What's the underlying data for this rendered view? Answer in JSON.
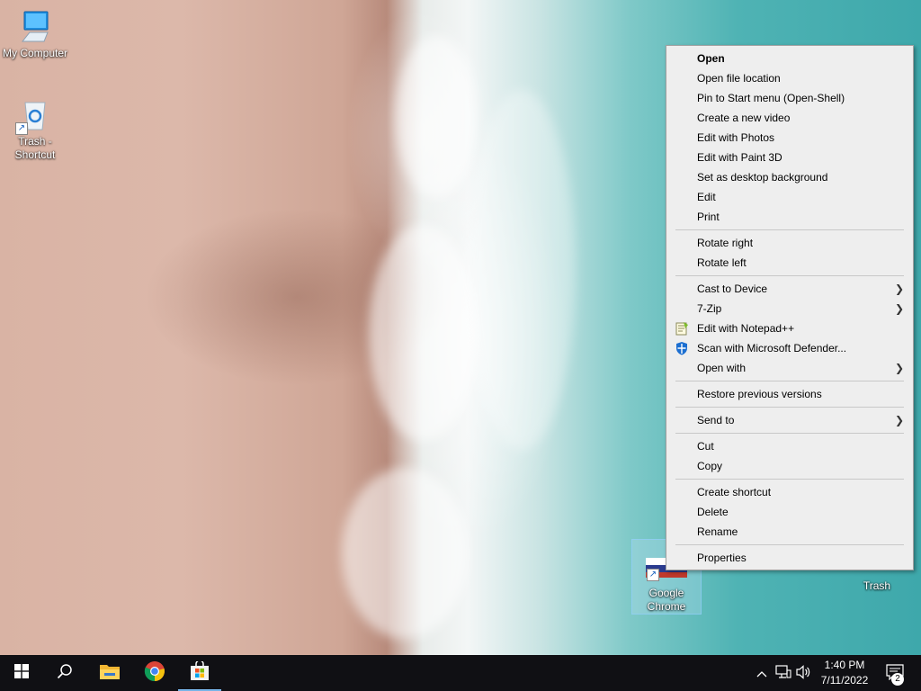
{
  "desktop": {
    "icons": [
      {
        "label": "My Computer"
      },
      {
        "label": "Trash - Shortcut"
      },
      {
        "label": "Google Chrome"
      },
      {
        "label": "Trash"
      }
    ]
  },
  "context_menu": {
    "groups": [
      [
        "Open",
        "Open file location",
        "Pin to Start menu (Open-Shell)",
        "Create a new video",
        "Edit with Photos",
        "Edit with Paint 3D",
        "Set as desktop background",
        "Edit",
        "Print"
      ],
      [
        "Rotate right",
        "Rotate left"
      ],
      [
        "Cast to Device",
        "7-Zip",
        "Edit with Notepad++",
        "Scan with Microsoft Defender...",
        "Open with"
      ],
      [
        "Restore previous versions"
      ],
      [
        "Send to"
      ],
      [
        "Cut",
        "Copy"
      ],
      [
        "Create shortcut",
        "Delete",
        "Rename"
      ],
      [
        "Properties"
      ]
    ]
  },
  "taskbar": {
    "clock_time": "1:40 PM",
    "clock_date": "7/11/2022",
    "notification_count": "2",
    "pinned": [
      "windows-start-icon",
      "search-icon",
      "file-explorer-icon",
      "chrome-icon",
      "store-icon"
    ],
    "tray": [
      "chevron-up-icon",
      "network-icon",
      "volume-icon",
      "notification-icon"
    ]
  },
  "colors": {
    "menu_bg": "#eeeeee",
    "taskbar_bg": "#101014",
    "accent": "#78b4e8"
  }
}
